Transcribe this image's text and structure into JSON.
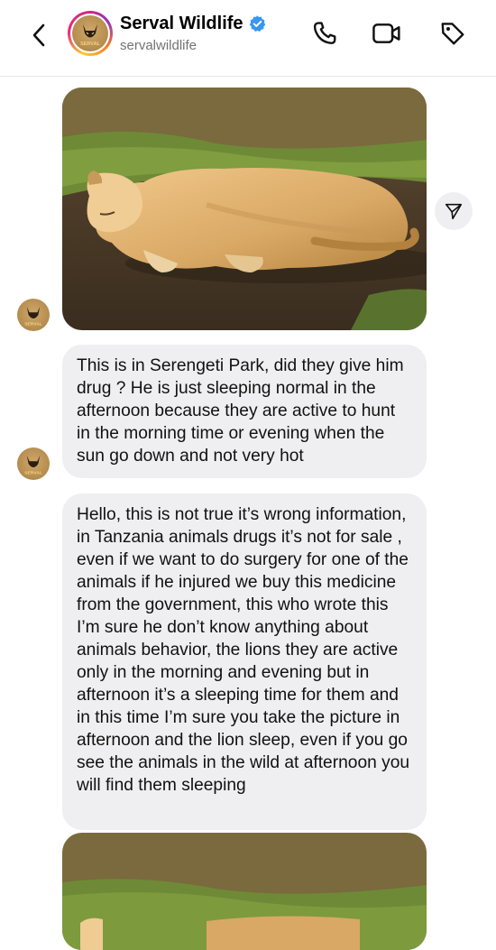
{
  "header": {
    "display_name": "Serval Wildlife",
    "username": "servalwildlife",
    "avatar_text": "SERVAL",
    "icons": {
      "back": "chevron-left-icon",
      "verified": "verified-badge-icon",
      "phone": "phone-icon",
      "video": "video-camera-icon",
      "tag": "tag-icon"
    }
  },
  "messages": [
    {
      "type": "image",
      "description_icon": "lioness-photo",
      "share_icon": "send-icon"
    },
    {
      "type": "text",
      "text": "This is in Serengeti Park, did they give him drug ? He is just sleeping normal in the afternoon because they are active to hunt in the morning time or evening when the sun go down and not very hot"
    },
    {
      "type": "text",
      "text": "Hello, this is not true it’s wrong information, in Tanzania animals drugs it’s not for sale , even if we want to do surgery for one of the animals if he injured we buy this medicine from the government, this who wrote this I’m sure he don’t know anything about animals behavior, the lions they are active only in the morning and evening but in afternoon it’s a sleeping time for them and in this time I’m sure you take the picture in afternoon and the lion sleep, even if you go see the animals in the wild at afternoon you will find them sleeping"
    },
    {
      "type": "image",
      "description_icon": "lioness-photo"
    }
  ],
  "colors": {
    "bubble_bg": "#efeff1",
    "verified_blue": "#3897f0",
    "secondary_text": "#737373"
  }
}
